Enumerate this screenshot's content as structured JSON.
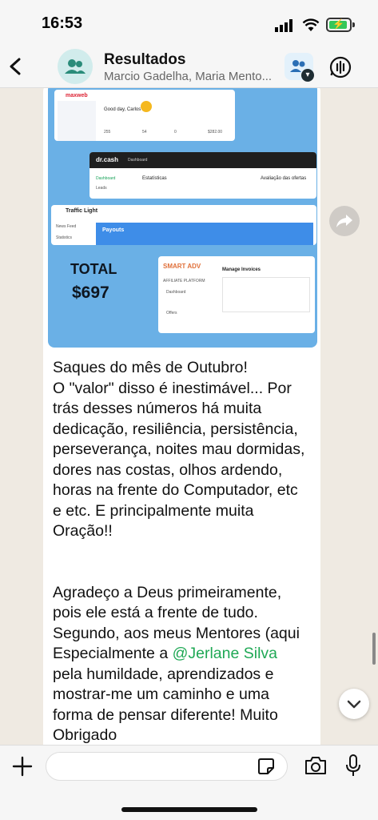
{
  "status_bar": {
    "time": "16:53"
  },
  "header": {
    "title": "Resultados",
    "subtitle": "Marcio Gadelha, Maria Mento..."
  },
  "image": {
    "dash1": {
      "logo": "maxweb",
      "greeting": "Good day, Carlos",
      "values": [
        "255",
        "54",
        "0",
        "$282.00"
      ]
    },
    "dash2": {
      "logo": "dr.cash",
      "tab": "Dashboard",
      "heading": "Estatísticas",
      "side": "Avaliação das ofertas",
      "menu": "Dashboard",
      "menu2": "Leads"
    },
    "dash3": {
      "logo": "Traffic Light",
      "menu1": "News Feed",
      "menu2": "Statistics",
      "banner": "Payouts"
    },
    "dash4": {
      "logo": "SMART ADV",
      "heading": "Manage Invoices",
      "sub1": "AFFILIATE PLATFORM",
      "sub2": "Dashboard",
      "sub3": "Offers"
    },
    "total_label": "TOTAL",
    "total_value": "$697"
  },
  "message": {
    "paragraph1": "Saques do mês de Outubro!\nO \"valor\" disso é inestimável... Por trás desses números há muita dedicação, resiliência, persistência, perseverança, noites mau dormidas, dores nas costas, olhos ardendo, horas na frente do Computador, etc e etc. E principalmente muita Oração!!",
    "p2_before": "Agradeço a Deus primeiramente, pois ele está a frente de tudo. Segundo, aos meus Mentores (aqui Especialmente a ",
    "mention": "@Jerlane Silva",
    "p2_after": " pela humildade, aprendizados e mostrar-me um caminho e uma forma de pensar diferente! Muito Obrigado"
  },
  "input": {
    "placeholder": ""
  },
  "colors": {
    "accent": "#1fa855",
    "bubble": "#ffffff",
    "wallpaper": "#efeae2"
  }
}
